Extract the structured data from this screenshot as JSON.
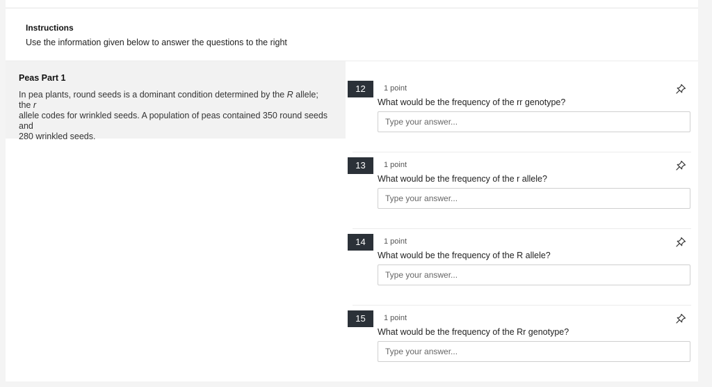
{
  "instructions": {
    "heading": "Instructions",
    "text": "Use the information given below to answer the questions to the right"
  },
  "passage": {
    "title": "Peas Part 1",
    "line1_a": "In pea plants, round seeds is a dominant condition determined by the ",
    "line1_allele_R": "R",
    "line1_b": " allele; the ",
    "line1_allele_r": "r",
    "line2": "allele codes for wrinkled seeds. A population of peas contained 350 round seeds",
    "line3": "and",
    "line4": "280 wrinkled seeds."
  },
  "questions": [
    {
      "number": "12",
      "points": "1 point",
      "text": "What would be the frequency of the rr genotype?",
      "placeholder": "Type your answer...",
      "value": ""
    },
    {
      "number": "13",
      "points": "1 point",
      "text": "What would be the frequency of the r allele?",
      "placeholder": "Type your answer...",
      "value": ""
    },
    {
      "number": "14",
      "points": "1 point",
      "text": "What would be the frequency of the R allele?",
      "placeholder": "Type your answer...",
      "value": ""
    },
    {
      "number": "15",
      "points": "1 point",
      "text": "What would be the frequency of the Rr genotype?",
      "placeholder": "Type your answer...",
      "value": ""
    }
  ],
  "icons": {
    "pin": "pin-icon"
  },
  "colors": {
    "number_badge_bg": "#2b3138",
    "passage_bg": "#f2f2f2"
  }
}
